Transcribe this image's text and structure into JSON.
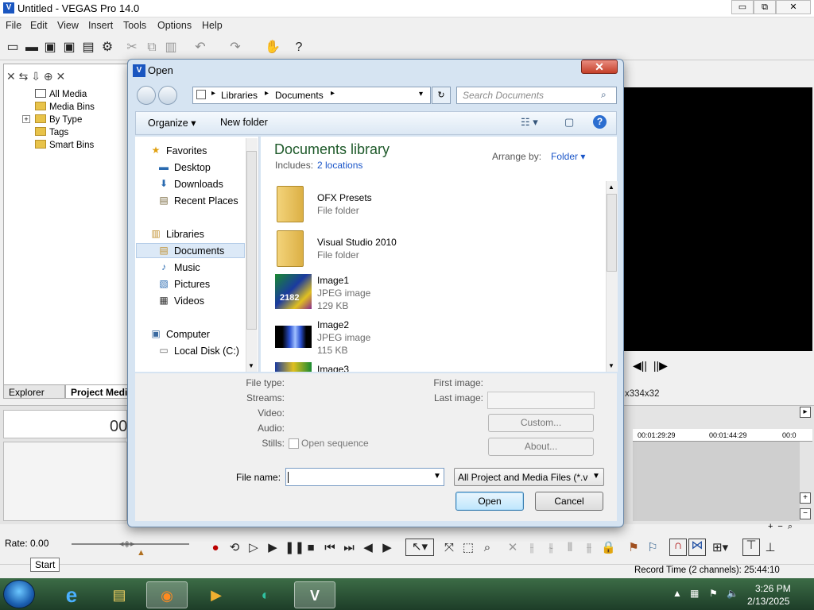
{
  "app": {
    "title": "Untitled - VEGAS Pro 14.0",
    "icon": "vegas-logo-icon",
    "window_buttons": [
      "▭",
      "⧉",
      "✕"
    ],
    "menu": [
      "File",
      "Edit",
      "View",
      "Insert",
      "Tools",
      "Options",
      "Help"
    ],
    "toolbar_icons": [
      "new-icon",
      "open-icon",
      "save-icon",
      "save-as-icon",
      "properties-icon",
      "cut-icon",
      "copy-icon",
      "paste-icon",
      "undo-icon",
      "redo-icon",
      "hand-icon",
      "whats-this-icon"
    ]
  },
  "explorer": {
    "tree": [
      "All Media",
      "Media Bins",
      "By Type",
      "Tags",
      "Smart Bins"
    ],
    "expand_marker": "+",
    "tabs": [
      "Explorer",
      "Project Media"
    ]
  },
  "preview": {
    "info": "x334x32",
    "controls": [
      "◀||",
      "||▶"
    ]
  },
  "timeline": {
    "time_display": "00",
    "ruler_marks": [
      "00:01:29:29",
      "00:01:44:29",
      "00:0"
    ]
  },
  "transport": {
    "rate_label": "Rate: 0.00",
    "start_tip": "Start",
    "status_text": "Record Time (2 channels): 25:44:10"
  },
  "dialog": {
    "title": "Open",
    "close_glyph": "✕",
    "address": {
      "crumbs": [
        "Libraries",
        "Documents"
      ],
      "separator": "▸",
      "dropdown": "▾",
      "refresh": "↻"
    },
    "search_placeholder": "Search Documents",
    "toolbar": {
      "organize": "Organize ▾",
      "new_folder": "New folder",
      "view": "☷ ▾",
      "pane": "▢",
      "help": "?"
    },
    "nav": {
      "favorites_header": "Favorites",
      "favorites": [
        "Desktop",
        "Downloads",
        "Recent Places"
      ],
      "libraries_header": "Libraries",
      "libraries": [
        "Documents",
        "Music",
        "Pictures",
        "Videos"
      ],
      "computer_header": "Computer",
      "computer": [
        "Local Disk (C:)"
      ]
    },
    "library": {
      "title": "Documents library",
      "includes_label": "Includes:",
      "locations": "2 locations",
      "arrange_label": "Arrange by:",
      "arrange_value": "Folder ▾"
    },
    "files": [
      {
        "name": "OFX Presets",
        "type": "File folder",
        "size": ""
      },
      {
        "name": "Visual Studio 2010",
        "type": "File folder",
        "size": ""
      },
      {
        "name": "Image1",
        "type": "JPEG image",
        "size": "129 KB"
      },
      {
        "name": "Image2",
        "type": "JPEG image",
        "size": "115 KB"
      },
      {
        "name": "Image3",
        "type": "",
        "size": ""
      }
    ],
    "thumb1_text": "2182",
    "details": {
      "file_type": "File type:",
      "streams": "Streams:",
      "video": "Video:",
      "audio": "Audio:",
      "stills": "Stills:",
      "open_sequence": "Open sequence",
      "first_image": "First image:",
      "last_image": "Last image:",
      "custom": "Custom...",
      "about": "About..."
    },
    "file_name_label": "File name:",
    "file_name_value": "",
    "file_type_filter": "All Project and Media Files (*.ve",
    "open_button": "Open",
    "cancel_button": "Cancel"
  },
  "taskbar": {
    "time": "3:26 PM",
    "date": "2/13/2025",
    "apps": [
      "internet-explorer-icon",
      "file-explorer-icon",
      "firefox-icon",
      "media-player-icon",
      "edge-icon",
      "vegas-icon"
    ]
  }
}
